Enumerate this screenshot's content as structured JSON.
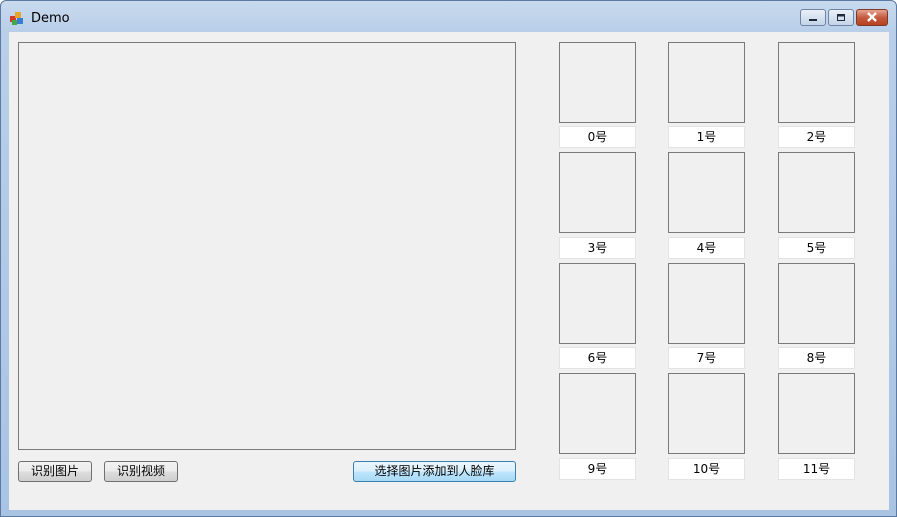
{
  "window": {
    "title": "Demo"
  },
  "buttons": {
    "recognize_image": "识别图片",
    "recognize_video": "识别视频",
    "add_to_library": "选择图片添加到人脸库"
  },
  "slots": [
    "0号",
    "1号",
    "2号",
    "3号",
    "4号",
    "5号",
    "6号",
    "7号",
    "8号",
    "9号",
    "10号",
    "11号"
  ]
}
